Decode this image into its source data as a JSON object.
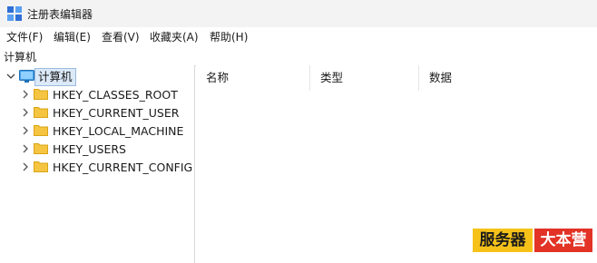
{
  "window": {
    "title": "注册表编辑器",
    "app_icon": "regedit-icon"
  },
  "menu": [
    "文件(F)",
    "编辑(E)",
    "查看(V)",
    "收藏夹(A)",
    "帮助(H)"
  ],
  "address": "计算机",
  "tree": {
    "root": {
      "label": "计算机",
      "icon": "computer-icon",
      "expanded": true
    },
    "children": [
      {
        "label": "HKEY_CLASSES_ROOT",
        "icon": "folder-icon"
      },
      {
        "label": "HKEY_CURRENT_USER",
        "icon": "folder-icon"
      },
      {
        "label": "HKEY_LOCAL_MACHINE",
        "icon": "folder-icon"
      },
      {
        "label": "HKEY_USERS",
        "icon": "folder-icon"
      },
      {
        "label": "HKEY_CURRENT_CONFIG",
        "icon": "folder-icon"
      }
    ]
  },
  "list": {
    "columns": [
      "名称",
      "类型",
      "数据"
    ]
  },
  "watermark": {
    "part1": "服务器",
    "part2": "大本营"
  },
  "colors": {
    "folder": "#f5c542",
    "selection": "#dbe9f8",
    "titlebar": "#f3f3f3"
  }
}
